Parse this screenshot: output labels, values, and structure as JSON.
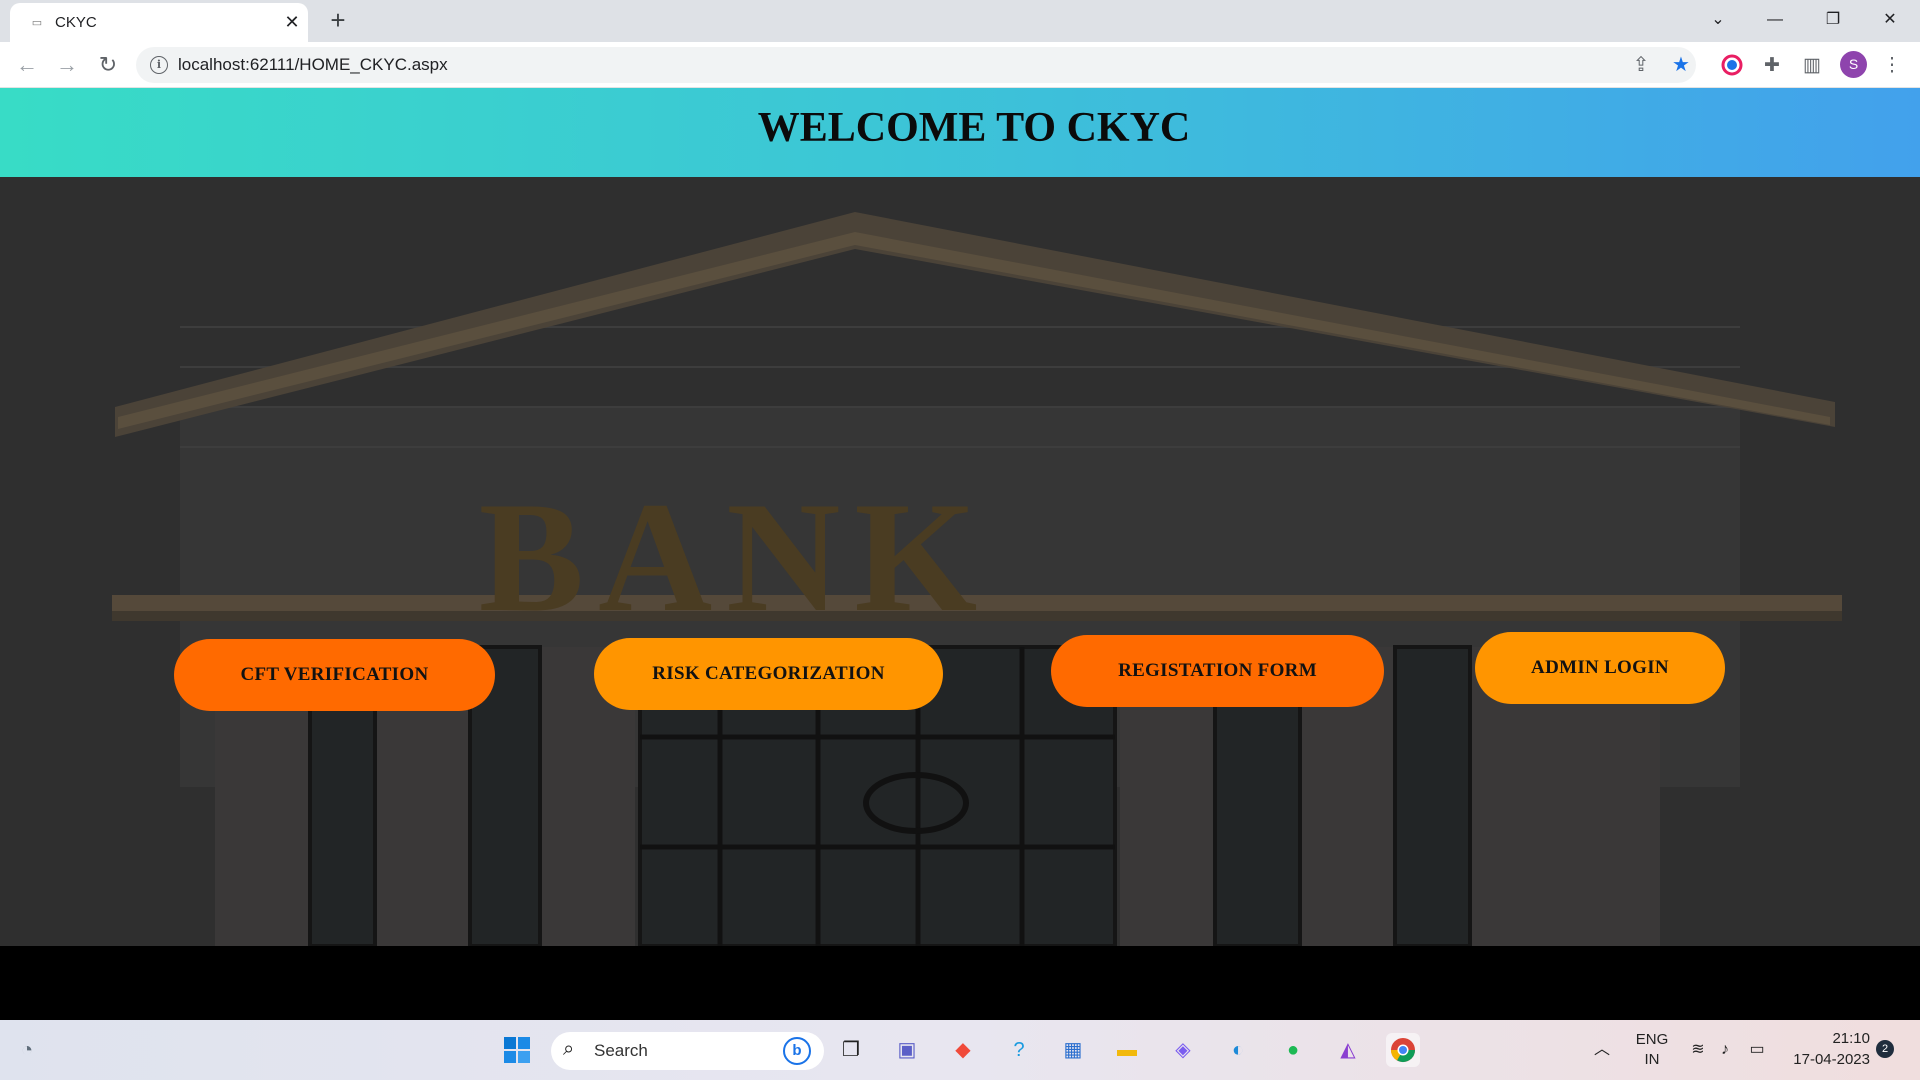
{
  "browser": {
    "tab_title": "CKYC",
    "url": "localhost:62111/HOME_CKYC.aspx",
    "profile_initial": "S"
  },
  "page": {
    "title": "WELCOME TO CKYC",
    "background_sign": "BANK",
    "buttons": [
      {
        "label": "CFT VERIFICATION",
        "color": "#ff6a00"
      },
      {
        "label": "RISK CATEGORIZATION",
        "color": "#ff9500"
      },
      {
        "label": "REGISTATION FORM",
        "color": "#ff6a00"
      },
      {
        "label": "ADMIN LOGIN",
        "color": "#ff9500"
      }
    ],
    "header_gradient": [
      "#38dcc6",
      "#42a1ec"
    ]
  },
  "taskbar": {
    "search_label": "Search",
    "language": "ENG",
    "region": "IN",
    "time": "21:10",
    "date": "17-04-2023",
    "notification_count": "2"
  }
}
